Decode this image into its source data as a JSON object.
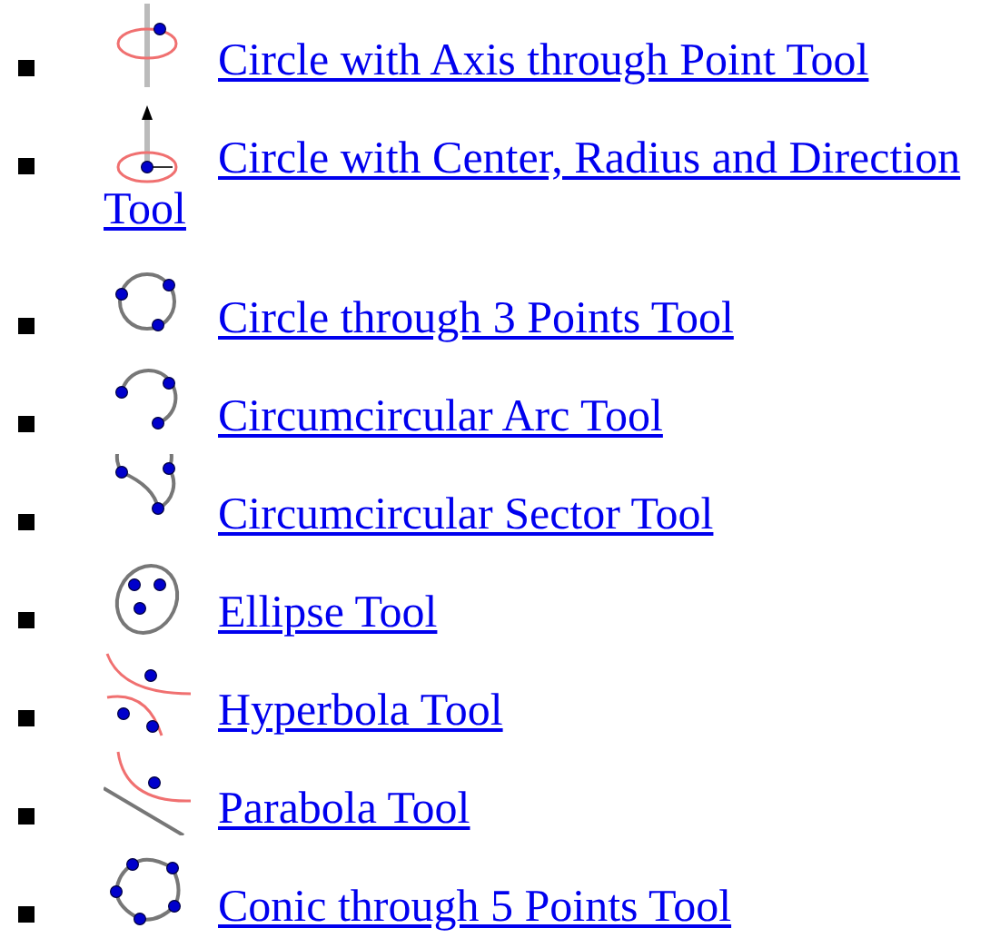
{
  "tool_links": [
    {
      "label": "Circle with Axis through Point Tool"
    },
    {
      "label": "Circle with Center, Radius and Direction Tool"
    },
    {
      "label": "Circle through 3 Points Tool"
    },
    {
      "label": "Circumcircular Arc Tool"
    },
    {
      "label": "Circumcircular Sector Tool"
    },
    {
      "label": "Ellipse Tool"
    },
    {
      "label": "Hyperbola Tool"
    },
    {
      "label": "Parabola Tool"
    },
    {
      "label": "Conic through 5 Points Tool"
    }
  ]
}
